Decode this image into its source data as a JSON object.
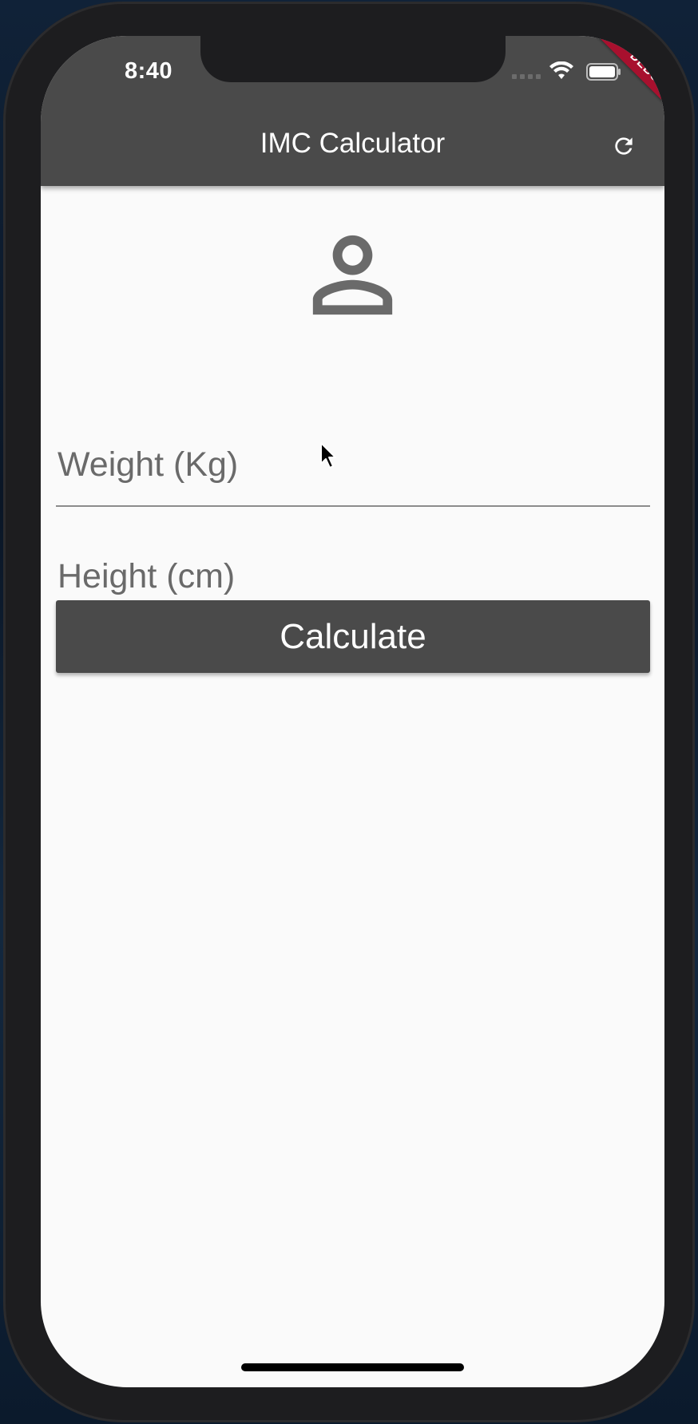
{
  "status_bar": {
    "time": "8:40",
    "icons": [
      "cellular-signal-icon",
      "wifi-icon",
      "battery-icon"
    ]
  },
  "debug_banner": {
    "label": "DEBUG",
    "color": "#a8102e"
  },
  "app_bar": {
    "title": "IMC Calculator",
    "action_icon": "refresh-icon",
    "background": "#4a4a4a"
  },
  "header_icon": "person-outline-icon",
  "form": {
    "weight": {
      "placeholder": "Weight (Kg)",
      "value": ""
    },
    "height": {
      "placeholder": "Height (cm)",
      "value": ""
    },
    "calculate_label": "Calculate"
  },
  "colors": {
    "primary": "#4a4a4a",
    "background": "#fafafa",
    "icon_grey": "#6a6a6a"
  }
}
